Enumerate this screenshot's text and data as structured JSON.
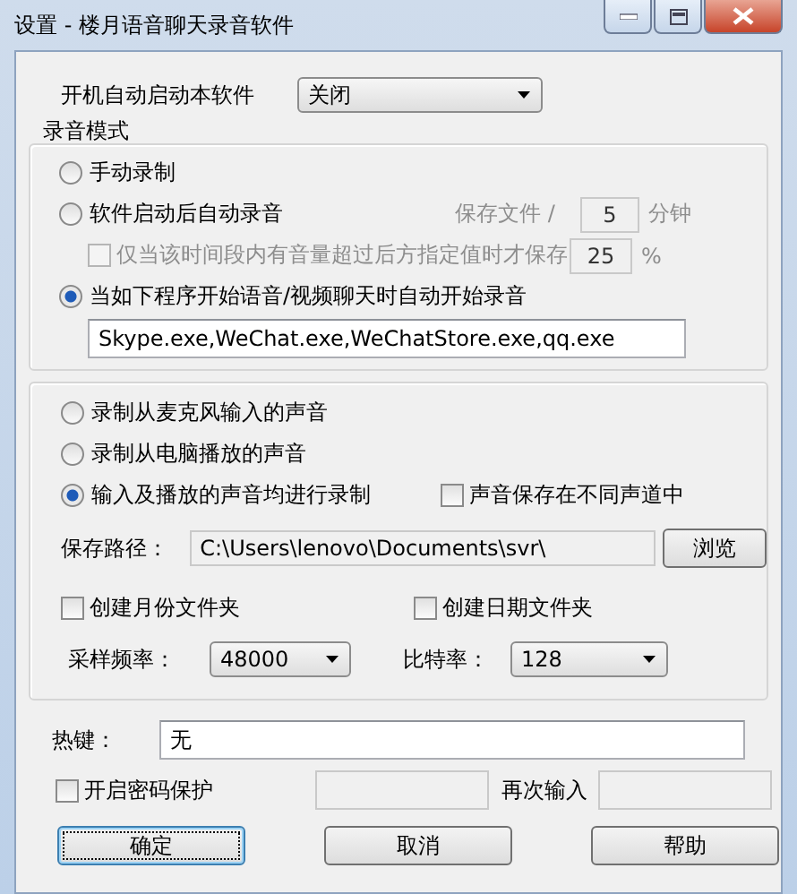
{
  "window": {
    "title": "设置 - 楼月语音聊天录音软件"
  },
  "autostart": {
    "label": "开机自动启动本软件",
    "value": "关闭"
  },
  "record_mode": {
    "title": "录音模式",
    "options": [
      {
        "label": "手动录制",
        "selected": false
      },
      {
        "label": "软件启动后自动录音",
        "selected": false
      },
      {
        "label": "当如下程序开始语音/视频聊天时自动开始录音",
        "selected": true
      }
    ],
    "save_every": {
      "label": "保存文件 /",
      "value": "5",
      "unit": "分钟",
      "disabled": true
    },
    "volume_only": {
      "label": "仅当该时间段内有音量超过后方指定值时才保存",
      "checked": false,
      "disabled": true,
      "value": "25",
      "unit": "%"
    },
    "programs": "Skype.exe,WeChat.exe,WeChatStore.exe,qq.exe"
  },
  "source": {
    "options": [
      {
        "label": "录制从麦克风输入的声音",
        "selected": false
      },
      {
        "label": "录制从电脑播放的声音",
        "selected": false
      },
      {
        "label": "输入及播放的声音均进行录制",
        "selected": true
      }
    ],
    "separate_channels": {
      "label": "声音保存在不同声道中",
      "checked": false
    },
    "save_path": {
      "label": "保存路径：",
      "value": "C:\\Users\\lenovo\\Documents\\svr\\"
    },
    "browse": "浏览",
    "month_folder": {
      "label": "创建月份文件夹",
      "checked": false
    },
    "date_folder": {
      "label": "创建日期文件夹",
      "checked": false
    },
    "sample_rate": {
      "label": "采样频率：",
      "value": "48000"
    },
    "bitrate": {
      "label": "比特率：",
      "value": "128"
    }
  },
  "hotkey": {
    "label": "热键：",
    "value": "无"
  },
  "password": {
    "label": "开启密码保护",
    "checked": false,
    "confirm_label": "再次输入"
  },
  "buttons": [
    {
      "label": "确定",
      "focused": true
    },
    {
      "label": "取消",
      "focused": false
    },
    {
      "label": "帮助",
      "focused": false
    }
  ]
}
